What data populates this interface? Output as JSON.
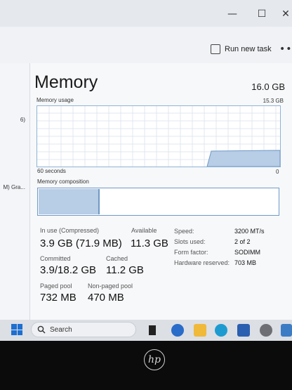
{
  "window": {
    "minimize_glyph": "—",
    "maximize_glyph": "☐",
    "close_glyph": "✕"
  },
  "toolbar": {
    "run_new_task": "Run new task",
    "more": "•••"
  },
  "sidebar": {
    "items": [
      {
        "label": "6)"
      },
      {
        "label": "M) Gra..."
      }
    ]
  },
  "memory": {
    "title": "Memory",
    "total": "16.0 GB",
    "usage_label": "Memory usage",
    "usage_max": "15.3 GB",
    "time_left": "60 seconds",
    "time_right": "0",
    "composition_label": "Memory composition",
    "in_use_fraction": 0.25,
    "stats": {
      "in_use_label": "In use (Compressed)",
      "in_use_value": "3.9 GB (71.9 MB)",
      "available_label": "Available",
      "available_value": "11.3 GB",
      "committed_label": "Committed",
      "committed_value": "3.9/18.2 GB",
      "cached_label": "Cached",
      "cached_value": "11.2 GB",
      "paged_label": "Paged pool",
      "paged_value": "732 MB",
      "nonpaged_label": "Non-paged pool",
      "nonpaged_value": "470 MB"
    },
    "specs": [
      {
        "label": "Speed:",
        "value": "3200 MT/s"
      },
      {
        "label": "Slots used:",
        "value": "2 of 2"
      },
      {
        "label": "Form factor:",
        "value": "SODIMM"
      },
      {
        "label": "Hardware reserved:",
        "value": "703 MB"
      }
    ]
  },
  "taskbar": {
    "search_label": "Search"
  },
  "colors": {
    "accent_blue": "#6f99c6",
    "fill_blue": "#b8cde6",
    "grid": "#e1e7ef"
  }
}
